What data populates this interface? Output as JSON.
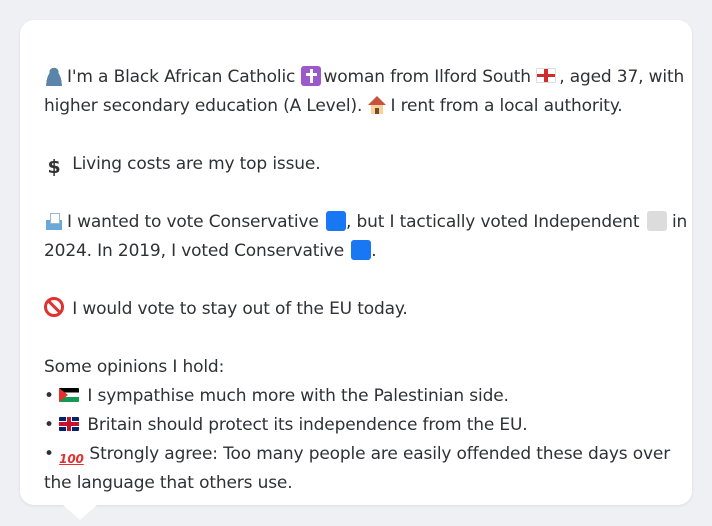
{
  "intro": {
    "line1_a": "I'm a Black African Catholic",
    "line1_b": "woman from Ilford South",
    "line1_c": ", aged 37, with",
    "line2_a": "higher secondary education (A Level).",
    "line2_b": "I rent from a local authority."
  },
  "issue": {
    "text": "Living costs are my top issue."
  },
  "vote": {
    "line1_a": "I wanted to vote Conservative",
    "line1_b": ", but I tactically voted Independent",
    "line1_c": "in",
    "line2_a": "2024. In 2019, I voted Conservative",
    "line2_b": "."
  },
  "eu": {
    "text": "I would vote to stay out of the EU today."
  },
  "opinions": {
    "heading": "Some opinions I hold:",
    "bullet": "•",
    "item1": "I sympathise much more with the Palestinian side.",
    "item2": "Britain should protect its independence from the EU.",
    "item3_line1": "Strongly agree: Too many people are easily offended these days over",
    "item3_line2": "the language that others use."
  },
  "icons": {
    "person": "person-icon",
    "religion": "latin-cross-icon",
    "region": "england-flag-icon",
    "housing": "house-icon",
    "issue": "dollar-icon",
    "vote": "ballot-box-icon",
    "eu": "prohibited-icon",
    "opinion1": "palestine-flag-icon",
    "opinion2": "uk-flag-icon",
    "opinion3": "hundred-points-icon"
  },
  "colors": {
    "conservative": "#1877f2",
    "independent": "#dcdcdc",
    "card_background": "#ffffff",
    "page_background": "#eef0f4",
    "text": "#2f3136"
  }
}
